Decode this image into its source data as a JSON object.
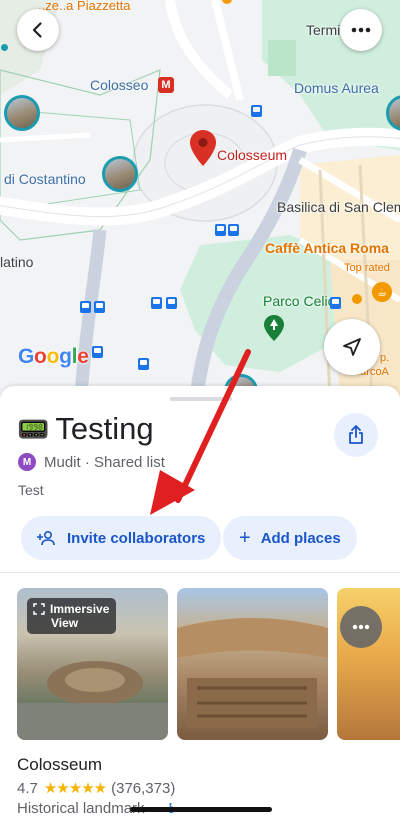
{
  "map": {
    "labels": {
      "termini": "Termi",
      "partial_top": "..ze..a Piazzetta",
      "colosseo_station": "Colosseo",
      "domus_aurea": "Domus Aurea",
      "colosseum": "Colosseum",
      "di_costantino": "di Costantino",
      "basilica": "Basilica di San Clem",
      "caffe": "Caffè Antica Roma",
      "top_rated": "Top rated",
      "parco_celio": "Parco Celio",
      "latino": "latino",
      "marco_line1": "p.",
      "marco_line2": "MarcoA"
    },
    "google_logo": [
      "G",
      "o",
      "o",
      "g",
      "l",
      "e"
    ],
    "google_colors": [
      "#4285f4",
      "#ea4335",
      "#fbbc05",
      "#4285f4",
      "#34a853",
      "#ea4335"
    ],
    "metro_badge": "M"
  },
  "list": {
    "emoji": "📟",
    "title": "Testing",
    "owner_initial": "M",
    "owner_text": "Mudit · Shared list",
    "description": "Test",
    "invite_label": "Invite collaborators",
    "add_places_label": "Add places"
  },
  "photos": {
    "immersive_line1": "Immersive",
    "immersive_line2": "View"
  },
  "place": {
    "name": "Colosseum",
    "rating": "4.7",
    "stars": "★★★★★",
    "reviews": "(376,373)",
    "category": "Historical landmark"
  },
  "colors": {
    "accent_blue": "#1a73e8",
    "pill_bg": "#e8f0fe",
    "pin_red": "#d93025",
    "annotation_arrow": "#e02020"
  }
}
